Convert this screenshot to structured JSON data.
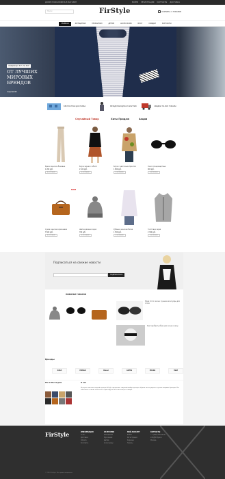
{
  "topbar": {
    "left": "ДОБРО ПОЖАЛОВАТЬ В МАГАЗИН",
    "links": [
      "ВОЙТИ",
      "РЕГИСТРАЦИЯ",
      "КОНТАКТЫ",
      "ДОСТАВКА"
    ]
  },
  "header": {
    "logo": "FirStyle",
    "search_placeholder": "Поиск",
    "cart": "КОРЗИНА: 0 ТОВАРОВ"
  },
  "nav": [
    "ГЛАВНАЯ",
    "ЖЕНЩИНАМ",
    "МУЖЧИНАМ",
    "ДЕТЯМ",
    "АКСЕССУАРЫ",
    "БЛОГ",
    "СКИДКИ",
    "КОНТАКТЫ"
  ],
  "hero": {
    "tag": "СКИДКИ ДО 50% НА ВСЕ",
    "title": "ОТ ЛУЧШИХ МИРОВЫХ БРЕНДОВ",
    "more": "ПОДРОБНЕЕ"
  },
  "features": [
    "БЕСПЛАТНАЯ ДОСТАВКА",
    "МЕЖДУНАРОДНАЯ ГАРАНТИЯ",
    "СКИДКИ НА ВСЕ ТОВАРЫ"
  ],
  "tabs": [
    "Случайный Товар",
    "Хиты Продаж",
    "Акции"
  ],
  "products_row1": [
    {
      "name": "Брюки женские бежевые",
      "price": "1 200 руб."
    },
    {
      "name": "Блуза черная с юбкой",
      "price": "2 100 руб."
    },
    {
      "name": "Блуза с цветочным принтом",
      "price": "1 800 руб."
    },
    {
      "name": "Очки солнцезащитные",
      "price": "900 руб."
    }
  ],
  "products_row2": [
    {
      "name": "Сумка женская коричневая",
      "price": "3 500 руб.",
      "badge": "NEW"
    },
    {
      "name": "Шапка вязаная серая",
      "price": "700 руб."
    },
    {
      "name": "Рубашка женская белая",
      "price": "1 500 руб."
    },
    {
      "name": "Толстовка серая",
      "price": "2 300 руб."
    }
  ],
  "buy_label": "В КОРЗИНУ",
  "subscribe": {
    "title": "Подписаться на свежие новости",
    "button": "ПОДПИСАТЬСЯ"
  },
  "lower": {
    "title": "НОВИНКИ ТОВАРОВ",
    "blog": [
      "Мода этого сезона: лучшие аксессуары для стиля",
      "Как подобрать образ для осени и зимы"
    ]
  },
  "brands": {
    "title": "Бренды",
    "items": [
      "ZARA",
      "MANGO",
      "Diesel",
      "GUESS",
      "PRADA",
      "H&M"
    ]
  },
  "info": {
    "gallery_title": "Мы в Инстаграм",
    "about_title": "О нас",
    "text": "Интернет-магазин модной одежды FirStyle предлагает широкий выбор одежды, обуви и аксессуаров от лучших мировых брендов. Мы заботимся о наших клиентах и гарантируем качество каждого товара."
  },
  "footer": {
    "logo": "FirStyle",
    "cols": [
      {
        "h": "ИНФОРМАЦИЯ",
        "items": [
          "О нас",
          "Доставка",
          "Оплата",
          "Контакты"
        ]
      },
      {
        "h": "КАТЕГОРИИ",
        "items": [
          "Женщинам",
          "Мужчинам",
          "Детям",
          "Аксессуары"
        ]
      },
      {
        "h": "МОЙ АККАУНТ",
        "items": [
          "Войти",
          "Регистрация",
          "Корзина",
          "Заказы"
        ]
      },
      {
        "h": "КОНТАКТЫ",
        "items": [
          "+7 (000) 000-00-00",
          "info@firstyle.ru",
          "Москва"
        ]
      }
    ],
    "copyright": "© 2016 FirStyle. Все права защищены."
  }
}
